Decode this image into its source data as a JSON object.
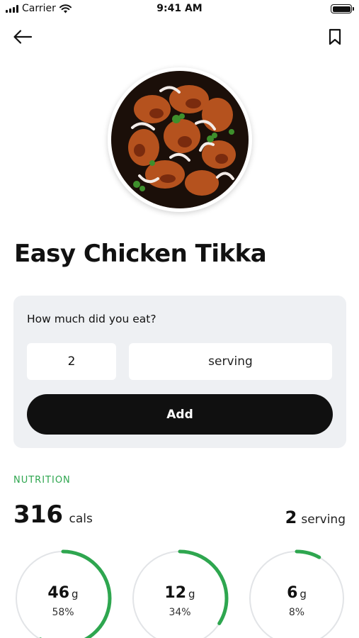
{
  "status_bar": {
    "carrier": "Carrier",
    "time": "9:41 AM"
  },
  "nav": {
    "back_icon": "arrow-left-icon",
    "bookmark_icon": "bookmark-icon"
  },
  "recipe": {
    "title": "Easy Chicken Tikka",
    "image": "chicken-tikka-photo"
  },
  "log": {
    "question": "How much did you eat?",
    "quantity": "2",
    "unit": "serving",
    "add_label": "Add"
  },
  "nutrition": {
    "section_label": "NUTRITION",
    "calories": "316",
    "calories_unit": "cals",
    "servings": "2",
    "servings_unit": "serving",
    "accent_color": "#2ea64f",
    "macros": [
      {
        "amount": "46",
        "unit": "g",
        "percent_label": "58%",
        "progress": 0.58
      },
      {
        "amount": "12",
        "unit": "g",
        "percent_label": "34%",
        "progress": 0.34
      },
      {
        "amount": "6",
        "unit": "g",
        "percent_label": "8%",
        "progress": 0.08
      }
    ]
  }
}
